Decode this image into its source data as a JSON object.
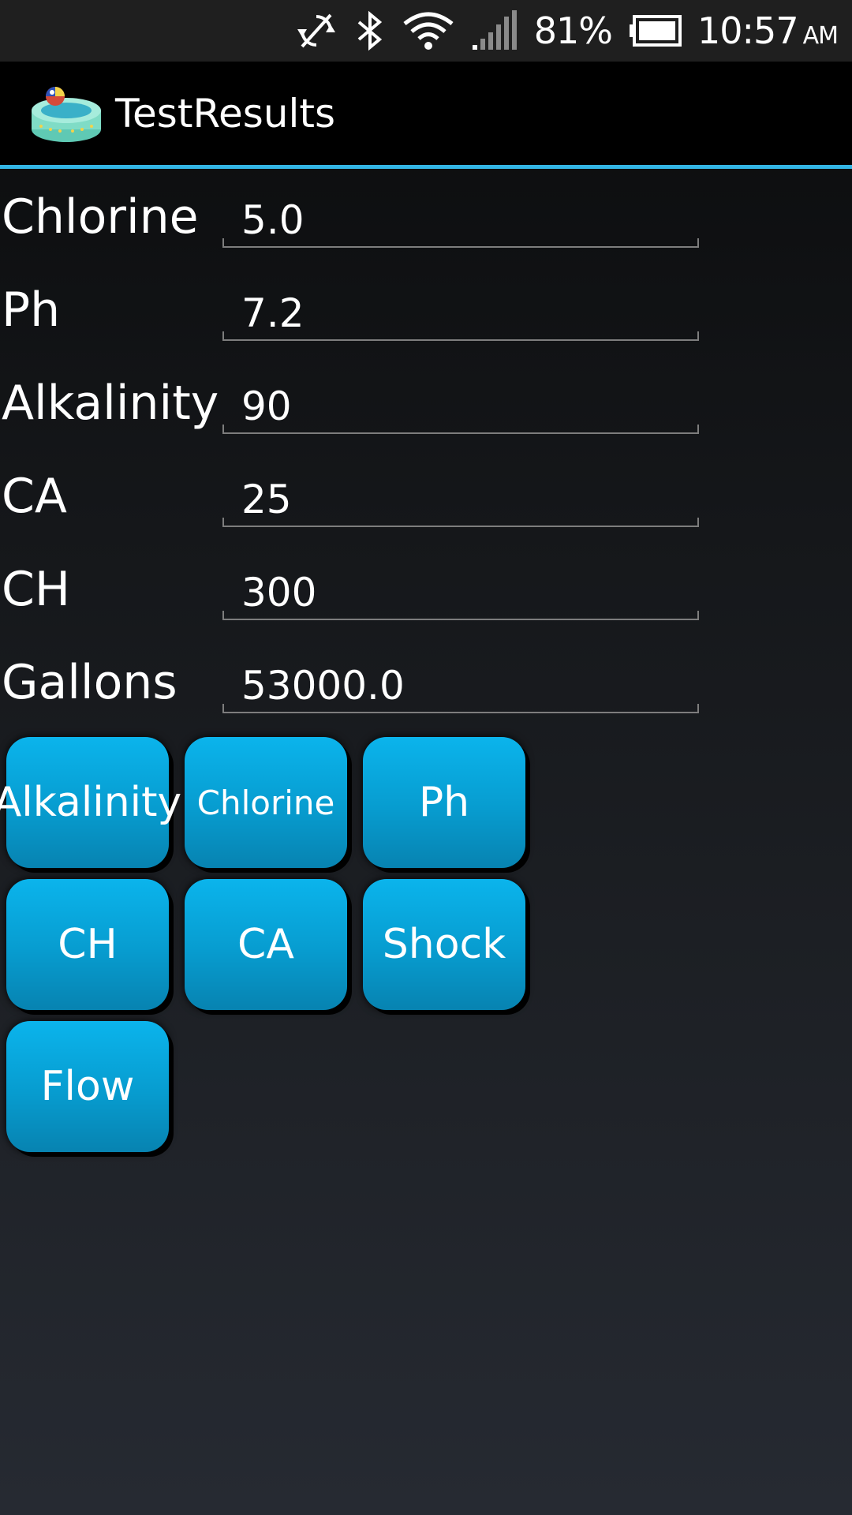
{
  "status_bar": {
    "icons": [
      "sync-off-icon",
      "bluetooth-icon",
      "wifi-icon",
      "signal-icon",
      "battery-icon"
    ],
    "battery_percent": "81%",
    "time": "10:57",
    "ampm": "AM"
  },
  "action_bar": {
    "app_icon": "pool-icon",
    "title": "TestResults",
    "accent_color": "#33b5e5"
  },
  "form": {
    "rows": [
      {
        "label": "Chlorine",
        "value": "5.0"
      },
      {
        "label": "Ph",
        "value": "7.2"
      },
      {
        "label": "Alkalinity",
        "value": "90"
      },
      {
        "label": "CA",
        "value": "25"
      },
      {
        "label": "CH",
        "value": "300"
      },
      {
        "label": "Gallons",
        "value": "53000.0"
      }
    ]
  },
  "buttons": {
    "alkalinity": "Alkalinity",
    "chlorine": "Chlorine",
    "ph": "Ph",
    "ch": "CH",
    "ca": "CA",
    "shock": "Shock",
    "flow": "Flow",
    "color": "#0aa8e0"
  }
}
